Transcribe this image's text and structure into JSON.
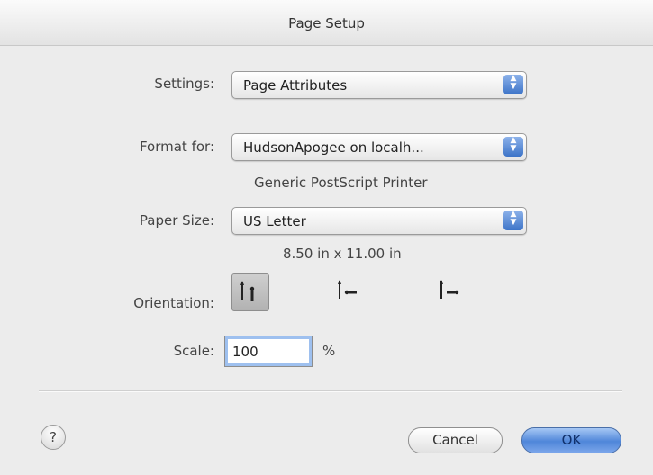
{
  "window": {
    "title": "Page Setup"
  },
  "settings": {
    "label": "Settings:",
    "value": "Page Attributes"
  },
  "format": {
    "label": "Format for:",
    "value": "HudsonApogee on localh...",
    "description": "Generic PostScript Printer"
  },
  "paper": {
    "label": "Paper Size:",
    "value": "US Letter",
    "dimensions": "8.50 in x 11.00 in"
  },
  "orientation": {
    "label": "Orientation:",
    "options": [
      "portrait",
      "landscape-left",
      "landscape-right"
    ],
    "selected": "portrait"
  },
  "scale": {
    "label": "Scale:",
    "value": "100",
    "unit": "%"
  },
  "buttons": {
    "help": "?",
    "cancel": "Cancel",
    "ok": "OK"
  }
}
